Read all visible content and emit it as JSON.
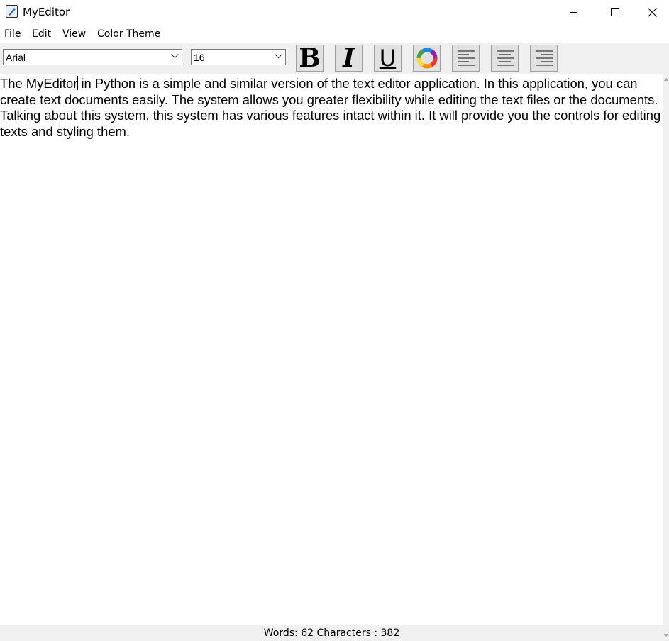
{
  "window": {
    "title": "MyEditor",
    "icon": "editor-app-icon"
  },
  "menu": {
    "items": [
      {
        "label": "File"
      },
      {
        "label": "Edit"
      },
      {
        "label": "View"
      },
      {
        "label": "Color Theme"
      }
    ]
  },
  "toolbar": {
    "font_family": "Arial",
    "font_size": "16",
    "bold_glyph": "B",
    "italic_glyph": "I",
    "underline_glyph": "U",
    "buttons": [
      "bold-icon",
      "italic-icon",
      "underline-icon",
      "color-wheel-icon",
      "align-left-icon",
      "align-center-icon",
      "align-right-icon"
    ]
  },
  "editor": {
    "text_before_caret": "The MyEditor",
    "text_after_caret": " in Python is a simple and similar version of the text editor application. In this application, you can create text documents easily. The system allows you greater flexibility while editing the text files or the documents. Talking about this system, this system has various features intact within it. It will provide you the controls for editing texts and styling them."
  },
  "status": {
    "text": "Words: 62 Characters : 382"
  }
}
